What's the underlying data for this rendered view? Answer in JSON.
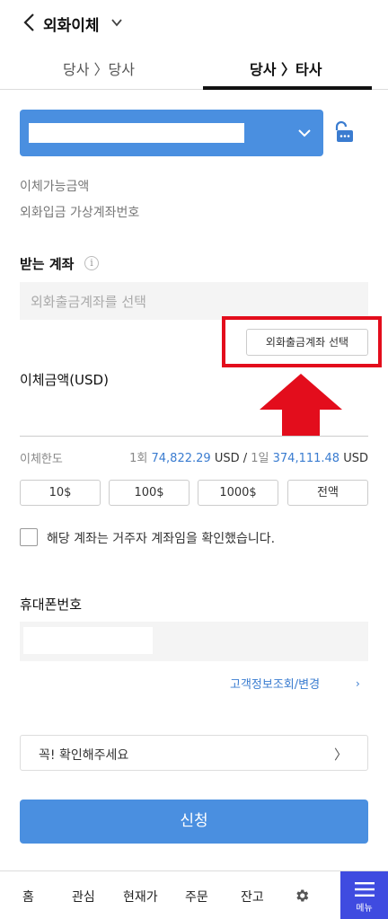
{
  "header": {
    "title": "외화이체"
  },
  "tabs": [
    {
      "label": "당사 〉당사"
    },
    {
      "label": "당사 〉타사"
    }
  ],
  "info": {
    "available_amount_label": "이체가능금액",
    "virtual_account_label": "외화입금 가상계좌번호"
  },
  "receive_account": {
    "title": "받는 계좌",
    "placeholder": "외화출금계좌를 선택",
    "select_button": "외화출금계좌 선택"
  },
  "amount": {
    "label": "이체금액(USD)"
  },
  "limit": {
    "label": "이체한도",
    "once_prefix": "1회",
    "once_value": "74,822.29",
    "currency": "USD",
    "separator": "/",
    "daily_prefix": "1일",
    "daily_value": "374,111.48"
  },
  "quick_buttons": [
    "10$",
    "100$",
    "1000$",
    "전액"
  ],
  "confirm_checkbox": {
    "label": "해당 계좌는 거주자 계좌임을 확인했습니다."
  },
  "phone": {
    "label": "휴대폰번호"
  },
  "customer_link": {
    "label": "고객정보조회/변경",
    "chevron": "›"
  },
  "notice": {
    "label": "꼭! 확인해주세요",
    "chevron": "〉"
  },
  "apply_button": {
    "label": "신청"
  },
  "bottom_nav": {
    "items": [
      "홈",
      "관심",
      "현재가",
      "주문",
      "잔고"
    ],
    "menu_label": "메뉴"
  },
  "colors": {
    "accent": "#4a8fe0",
    "link": "#3a7cd0",
    "highlight": "#e30d1c",
    "menu": "#3f4be0"
  },
  "icons": [
    "back-icon",
    "chevron-down-icon",
    "unlock-icon",
    "info-icon",
    "gear-icon",
    "menu-icon"
  ]
}
